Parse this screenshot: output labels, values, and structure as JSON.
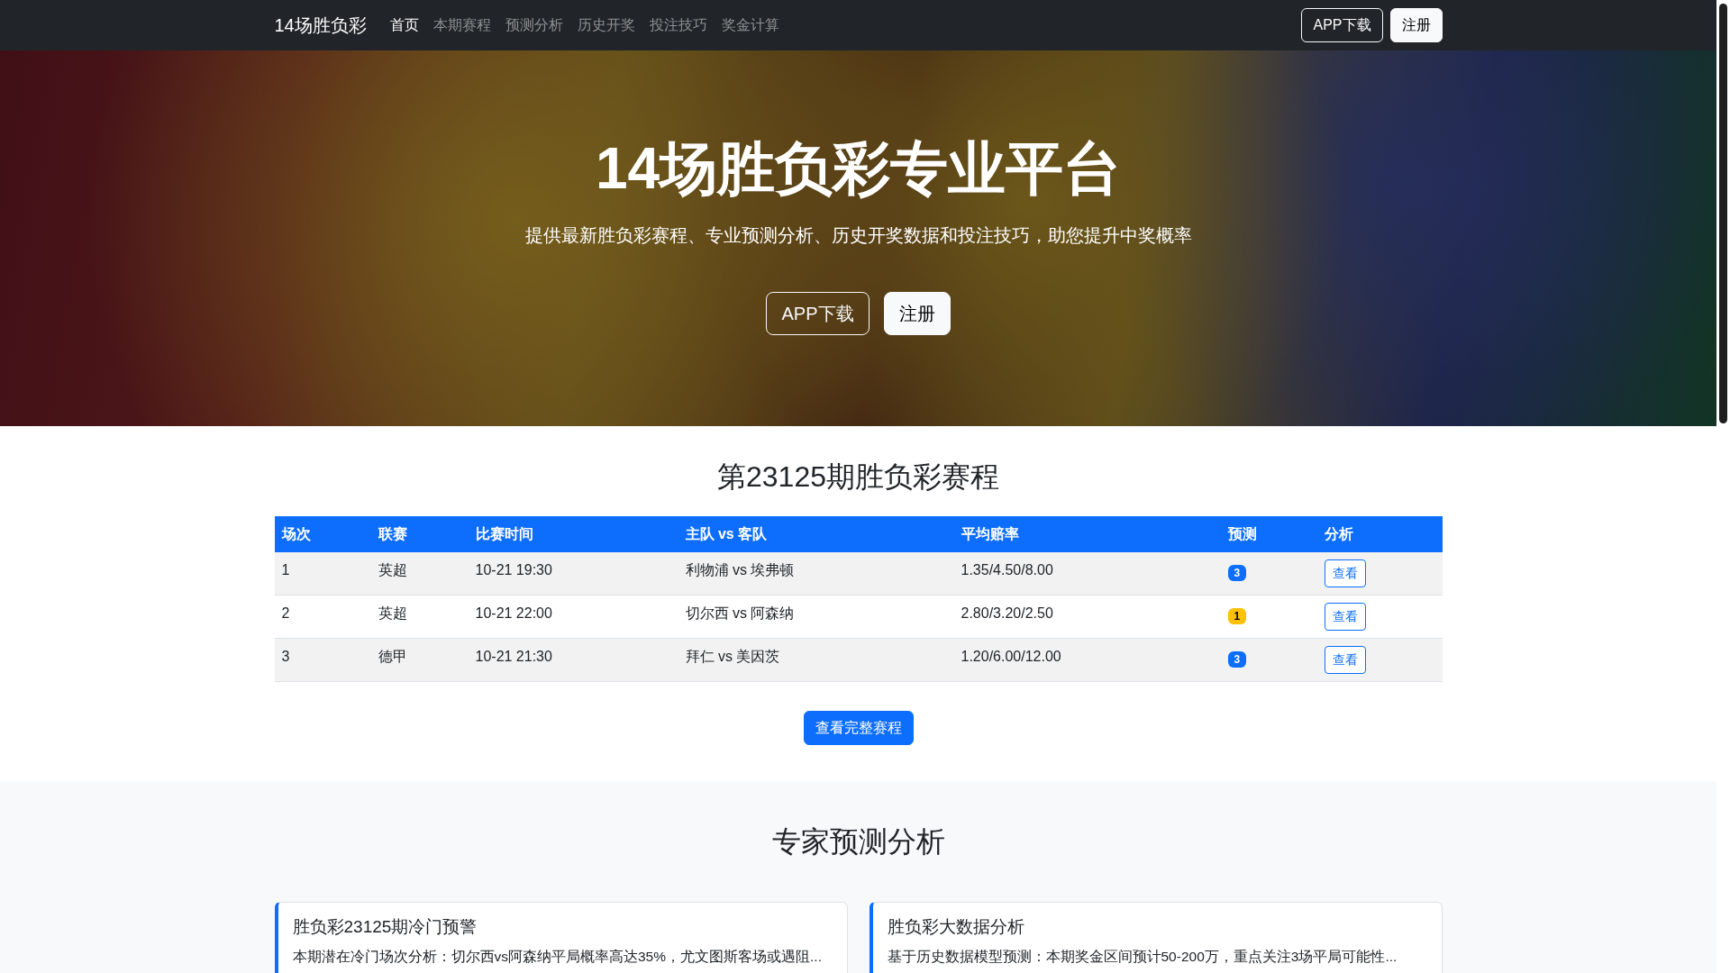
{
  "navbar": {
    "brand": "14场胜负彩",
    "links": [
      {
        "label": "首页",
        "selected": true
      },
      {
        "label": "本期赛程",
        "selected": false
      },
      {
        "label": "预测分析",
        "selected": false
      },
      {
        "label": "历史开奖",
        "selected": false
      },
      {
        "label": "投注技巧",
        "selected": false
      },
      {
        "label": "奖金计算",
        "selected": false
      }
    ],
    "buttons": [
      {
        "label": "APP下载",
        "kind": "outline"
      },
      {
        "label": "注册",
        "kind": "light"
      }
    ]
  },
  "hero": {
    "title": "14场胜负彩专业平台",
    "subtitle": "提供最新胜负彩赛程、专业预测分析、历史开奖数据和投注技巧，助您提升中奖概率",
    "buttons": [
      {
        "label": "APP下载",
        "kind": "outline"
      },
      {
        "label": "注册",
        "kind": "light"
      }
    ]
  },
  "schedule": {
    "title": "第23125期胜负彩赛程",
    "table": {
      "columns": [
        "场次",
        "联赛",
        "比赛时间",
        "主队 vs 客队",
        "平均赔率",
        "预测",
        "分析"
      ],
      "rows": [
        {
          "cells": [
            "1",
            "英超",
            "10-21 19:30",
            "利物浦 vs 埃弗顿",
            "1.35/4.50/8.00"
          ],
          "prediction": {
            "label": "3",
            "color": "#0d6efd"
          },
          "action": "查看"
        },
        {
          "cells": [
            "2",
            "英超",
            "10-21 22:00",
            "切尔西 vs 阿森纳",
            "2.80/3.20/2.50"
          ],
          "prediction": {
            "label": "1",
            "color": "#ffc107"
          },
          "action": "查看"
        },
        {
          "cells": [
            "3",
            "德甲",
            "10-21 21:30",
            "拜仁 vs 美因茨",
            "1.20/6.00/12.00"
          ],
          "prediction": {
            "label": "3",
            "color": "#0d6efd"
          },
          "action": "查看"
        }
      ]
    },
    "more_button": "查看完整赛程"
  },
  "analysis": {
    "title": "专家预测分析",
    "cards": [
      {
        "title": "胜负彩23125期冷门预警",
        "text": "本期潜在冷门场次分析：切尔西vs阿森纳平局概率高达35%，尤文图斯客场或遇阻..."
      },
      {
        "title": "胜负彩大数据分析",
        "text": "基于历史数据模型预测：本期奖金区间预计50-200万，重点关注3场平局可能性..."
      }
    ]
  }
}
